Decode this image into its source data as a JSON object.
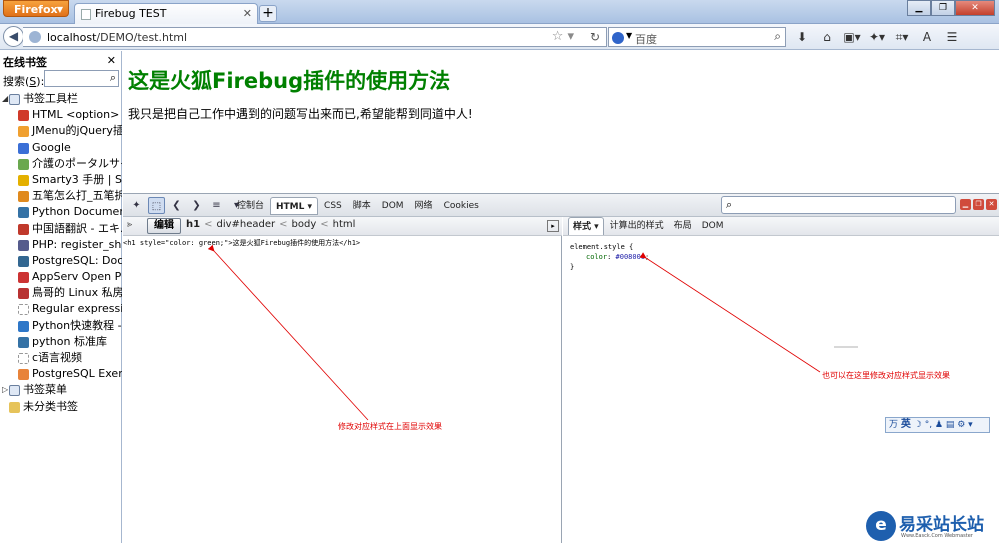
{
  "browser": {
    "menu_button": "Firefox",
    "tab_title": "Firebug TEST",
    "url_host": "localhost",
    "url_path": "/DEMO/test.html",
    "search_placeholder": "百度"
  },
  "sidebar": {
    "title": "在线书签",
    "search_label_prefix": "搜索(",
    "search_label_key": "S",
    "search_label_suffix": "):",
    "folder_toolbar": "书签工具栏",
    "items": [
      {
        "label": "HTML <option> ...",
        "color": "#d03a2a"
      },
      {
        "label": "JMenu的jQuery插...",
        "color": "#f0a030"
      },
      {
        "label": "Google",
        "color": "#3b6fd6"
      },
      {
        "label": "介護のポータルサイ...",
        "color": "#6aa84f"
      },
      {
        "label": "Smarty3 手册 | S...",
        "color": "#e4b000"
      },
      {
        "label": "五笔怎么打_五笔拆...",
        "color": "#e08a1e"
      },
      {
        "label": "Python Document...",
        "color": "#3572a5"
      },
      {
        "label": "中国語翻訳 - エキ...",
        "color": "#c0392b"
      },
      {
        "label": "PHP: register_shu...",
        "color": "#555b8c"
      },
      {
        "label": "PostgreSQL: Docu...",
        "color": "#336791"
      },
      {
        "label": "AppServ Open Pro...",
        "color": "#cc3333"
      },
      {
        "label": "鳥哥的 Linux 私房...",
        "color": "#b83232"
      },
      {
        "label": "Regular expressio...",
        "color": "#ffffff"
      },
      {
        "label": "Python快速教程 - ...",
        "color": "#2e77c8"
      },
      {
        "label": "python 标准库",
        "color": "#3572a5"
      },
      {
        "label": "c语言视频",
        "color": "#ffffff"
      },
      {
        "label": "PostgreSQL Exerci...",
        "color": "#e8833a"
      }
    ],
    "folder_menu": "书签菜单",
    "folder_unsorted": "未分类书签"
  },
  "page": {
    "heading": "这是火狐Firebug插件的使用方法",
    "description": "我只是把自己工作中遇到的问题写出来而已,希望能帮到同道中人!"
  },
  "firebug": {
    "tabs": [
      "控制台",
      "HTML ▾",
      "CSS",
      "脚本",
      "DOM",
      "网络",
      "Cookies"
    ],
    "edit_button": "编辑",
    "breadcrumb": [
      "h1",
      "div#header",
      "body",
      "html"
    ],
    "html_source": "<h1 style=\"color: green;\">这是火狐Firebug插件的使用方法</h1>",
    "side_tabs": [
      "样式 ▾",
      "计算出的样式",
      "布局",
      "DOM"
    ],
    "css_selector": "element.style {",
    "css_property": "color",
    "css_value": "#008000",
    "css_close": "}"
  },
  "annotations": {
    "left": "修改对应样式在上面显示效果",
    "right": "也可以在这里修改对应样式显示效果"
  },
  "ime": {
    "lang": "英",
    "symbols": "☽ °, ♟ ▤ ⚙ ▾"
  },
  "watermark": {
    "logo": "e",
    "text": "易采站长站",
    "sub": "Www.Easck.Com Webmaster"
  }
}
